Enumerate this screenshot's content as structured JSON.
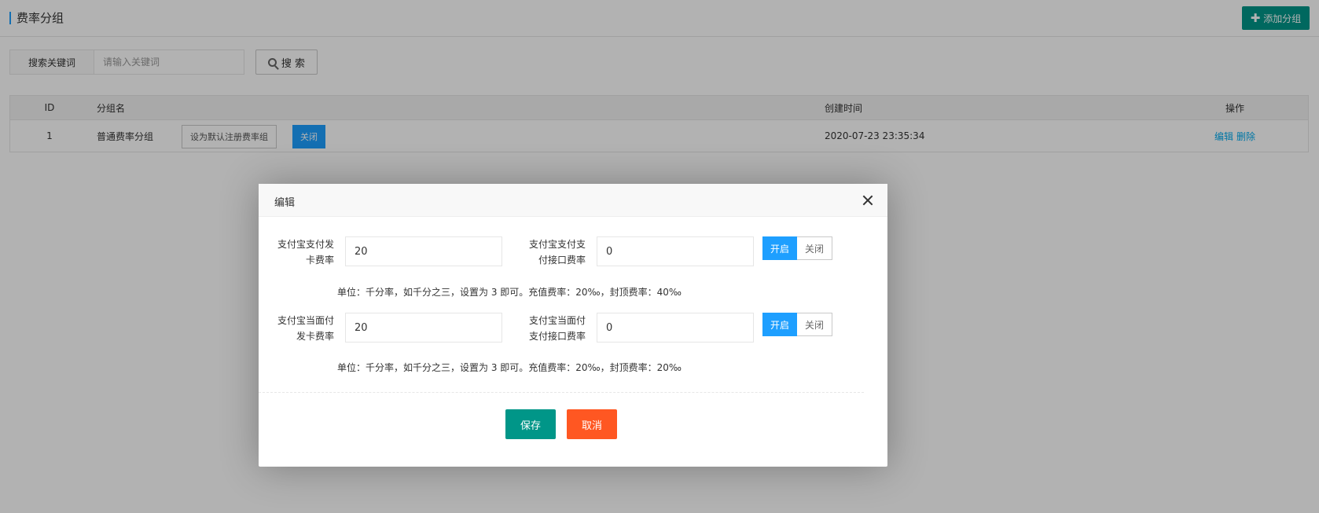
{
  "header": {
    "title": "费率分组",
    "add_button": "添加分组"
  },
  "search": {
    "label": "搜索关键词",
    "placeholder": "请输入关键词",
    "button": "搜 索"
  },
  "table": {
    "columns": [
      "ID",
      "分组名",
      "创建时间",
      "操作"
    ],
    "rows": [
      {
        "id": "1",
        "name": "普通费率分组",
        "set_default_label": "设为默认注册费率组",
        "status_label": "关闭",
        "created": "2020-07-23 23:35:34",
        "edit_label": "编辑",
        "delete_label": "删除"
      }
    ]
  },
  "modal": {
    "title": "编辑",
    "rows": [
      {
        "field1_label": "支付宝支付发卡费率",
        "field1_value": "20",
        "field2_label": "支付宝支付支付接口费率",
        "field2_value": "0",
        "toggle_on": "开启",
        "toggle_off": "关闭",
        "hint": "单位：千分率，如千分之三，设置为 3 即可。充值费率：20‰，封顶费率：40‰"
      },
      {
        "field1_label": "支付宝当面付发卡费率",
        "field1_value": "20",
        "field2_label": "支付宝当面付支付接口费率",
        "field2_value": "0",
        "toggle_on": "开启",
        "toggle_off": "关闭",
        "hint": "单位：千分率，如千分之三，设置为 3 即可。充值费率：20‰，封顶费率：20‰"
      }
    ],
    "save_label": "保存",
    "cancel_label": "取消"
  },
  "colors": {
    "primary_green": "#009688",
    "primary_blue": "#1e9fff",
    "danger_orange": "#ff5722",
    "link_blue": "#01aaed"
  }
}
